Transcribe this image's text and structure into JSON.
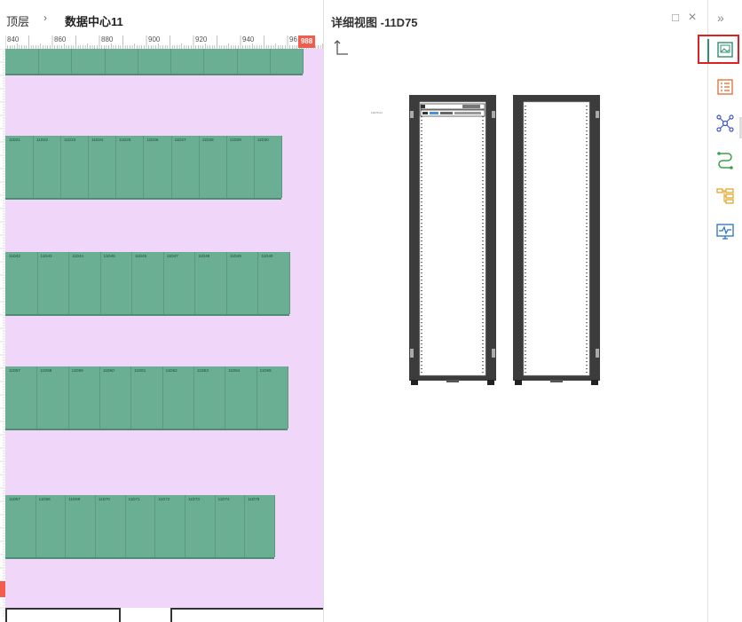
{
  "breadcrumb": {
    "top_level": "顶层",
    "separator": "›",
    "current": "数据中心11"
  },
  "ruler": {
    "labels": [
      "840",
      "860",
      "880",
      "900",
      "920",
      "940",
      "96"
    ],
    "marker_top": "988"
  },
  "floor": {
    "rows": [
      {
        "rack_labels": []
      },
      {
        "rack_labels": [
          "11D21",
          "11D22",
          "11D23",
          "11D24",
          "11D25",
          "11D26",
          "11D27",
          "11D28",
          "11D29",
          "11D30"
        ]
      },
      {
        "rack_labels": [
          "11D42",
          "11D43",
          "11D44",
          "11D45",
          "11D46",
          "11D47",
          "11D48",
          "11D49",
          "11D40"
        ]
      },
      {
        "rack_labels": [
          "11D57",
          "11D58",
          "11D59",
          "11D60",
          "11D61",
          "11D62",
          "11D63",
          "11D64",
          "11D65"
        ]
      },
      {
        "rack_labels": [
          "11D67",
          "11D68",
          "11D69",
          "11D70",
          "11D71",
          "11D72",
          "11D73",
          "11D74",
          "11D75"
        ]
      }
    ]
  },
  "detail": {
    "title": "详细视图 -11D75",
    "tiny_caption": "11D75 A1",
    "maximize_icon": "□",
    "close_icon": "×"
  },
  "toolbar": {
    "collapse_label": "»"
  },
  "colors": {
    "floor": "#f0d6f8",
    "rack": "#6aae93",
    "ruler_marker": "#f25c4c",
    "highlight": "#e02020",
    "accent": "#2f8f6f"
  }
}
